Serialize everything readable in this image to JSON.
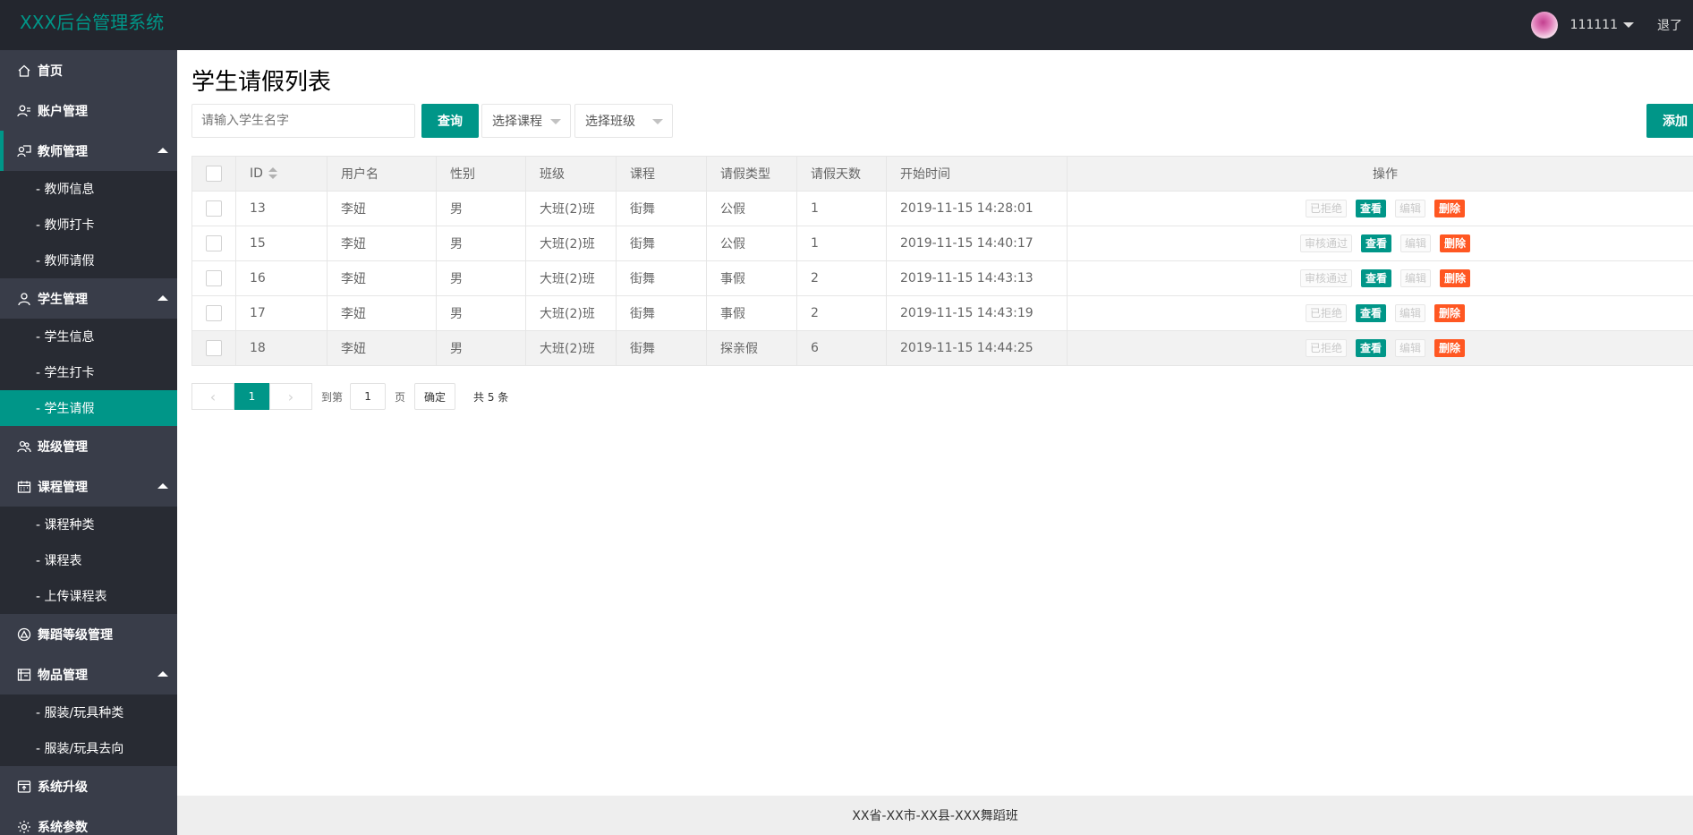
{
  "app": {
    "title": "XXX后台管理系统"
  },
  "header": {
    "username": "111111",
    "logout": "退了"
  },
  "sidebar": {
    "items": [
      {
        "label": "首页",
        "icon": "home-icon"
      },
      {
        "label": "账户管理",
        "icon": "user-list-icon"
      },
      {
        "label": "教师管理",
        "icon": "teacher-icon",
        "children": [
          "- 教师信息",
          "- 教师打卡",
          "- 教师请假"
        ]
      },
      {
        "label": "学生管理",
        "icon": "student-icon",
        "children": [
          "- 学生信息",
          "- 学生打卡",
          "- 学生请假"
        ]
      },
      {
        "label": "班级管理",
        "icon": "class-icon"
      },
      {
        "label": "课程管理",
        "icon": "calendar-icon",
        "children": [
          "- 课程种类",
          "- 课程表",
          "- 上传课程表"
        ]
      },
      {
        "label": "舞蹈等级管理",
        "icon": "level-icon"
      },
      {
        "label": "物品管理",
        "icon": "goods-icon",
        "children": [
          "- 服装/玩具种类",
          "- 服装/玩具去向"
        ]
      },
      {
        "label": "系统升级",
        "icon": "upgrade-icon"
      },
      {
        "label": "系统参数",
        "icon": "settings-icon"
      }
    ]
  },
  "main": {
    "title": "学生请假列表",
    "search": {
      "placeholder": "请输入学生名字",
      "button": "查询"
    },
    "filters": {
      "course": "选择课程",
      "class": "选择班级"
    },
    "add_button": "添加"
  },
  "table": {
    "columns": [
      "ID",
      "用户名",
      "性别",
      "班级",
      "课程",
      "请假类型",
      "请假天数",
      "开始时间",
      "操作"
    ],
    "rows": [
      {
        "id": "13",
        "user": "李妞",
        "gender": "男",
        "class": "大班(2)班",
        "course": "街舞",
        "type": "公假",
        "days": "1",
        "start": "2019-11-15 14:28:01",
        "status": "已拒绝"
      },
      {
        "id": "15",
        "user": "李妞",
        "gender": "男",
        "class": "大班(2)班",
        "course": "街舞",
        "type": "公假",
        "days": "1",
        "start": "2019-11-15 14:40:17",
        "status": "审核通过"
      },
      {
        "id": "16",
        "user": "李妞",
        "gender": "男",
        "class": "大班(2)班",
        "course": "街舞",
        "type": "事假",
        "days": "2",
        "start": "2019-11-15 14:43:13",
        "status": "审核通过"
      },
      {
        "id": "17",
        "user": "李妞",
        "gender": "男",
        "class": "大班(2)班",
        "course": "街舞",
        "type": "事假",
        "days": "2",
        "start": "2019-11-15 14:43:19",
        "status": "已拒绝"
      },
      {
        "id": "18",
        "user": "李妞",
        "gender": "男",
        "class": "大班(2)班",
        "course": "街舞",
        "type": "探亲假",
        "days": "6",
        "start": "2019-11-15 14:44:25",
        "status": "已拒绝"
      }
    ],
    "actions": {
      "view": "查看",
      "edit": "编辑",
      "delete": "删除"
    }
  },
  "pagination": {
    "current": "1",
    "goto_label": "到第",
    "page_value": "1",
    "page_unit": "页",
    "confirm": "确定",
    "total": "共 5 条"
  },
  "footer": {
    "text": "XX省-XX市-XX县-XXX舞蹈班"
  },
  "colors": {
    "primary": "#009688",
    "danger": "#ff5722",
    "header_bg": "#23262e",
    "sidebar_bg": "#393d49"
  }
}
